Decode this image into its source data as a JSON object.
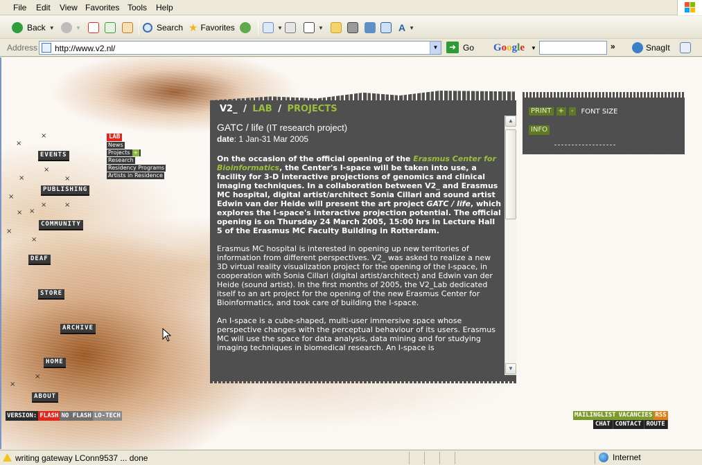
{
  "browser": {
    "menu": [
      "File",
      "Edit",
      "View",
      "Favorites",
      "Tools",
      "Help"
    ],
    "toolbar": {
      "back": "Back",
      "search": "Search",
      "favorites": "Favorites"
    },
    "address": {
      "label": "Address",
      "url": "http://www.v2.nl/",
      "go": "Go"
    },
    "google": {
      "brand": "Google",
      "chevron": "»",
      "snagit": "SnagIt"
    },
    "status": {
      "text": "writing gateway LConn9537 ... done",
      "zone": "Internet"
    }
  },
  "site": {
    "nav": {
      "events": "EVENTS",
      "publishing": "PUBLISHING",
      "community": "COMMUNITY",
      "deaf": "DEAF",
      "store": "STORE",
      "archive": "ARCHIVE",
      "home": "HOME",
      "about": "ABOUT"
    },
    "lab_menu": {
      "head": "LAB",
      "items": [
        "News",
        "Projects",
        "Research",
        "Residency Programs",
        "Artists in Residence"
      ],
      "plus": "+"
    },
    "version": {
      "label": "VERSION:",
      "flash": "FLASH",
      "noflash": "NO FLASH",
      "lotech": "LO-TECH"
    },
    "breadcrumb": {
      "v2": "V2_",
      "lab": "LAB",
      "projects": "PROJECTS",
      "sep": "/"
    },
    "article": {
      "title": "GATC / life",
      "subtitle": "(IT research project)",
      "date_label": "date",
      "date_value": ": 1 Jan-31 Mar 2005",
      "intro_a": "On the occasion of the official opening of the ",
      "intro_link": "Erasmus Center for Bioinformatics",
      "intro_b": ", the Center's I-space will be taken into use, a facility for 3-D interactive projections of genomics and clinical imaging techniques. In a collaboration between V2_ and Erasmus MC hospital, digital artist/architect Sonia Cillari and sound artist Edwin van der Heide will present the art project ",
      "intro_em": "GATC / life",
      "intro_c": ", which explores the I-space's interactive projection potential. The official opening is on Thursday 24 March 2005, 15:00 hrs in Lecture Hall 5 of the Erasmus MC Faculty Building in Rotterdam.",
      "para1": "Erasmus MC hospital is interested in opening up new territories of information from different perspectives. V2_ was asked to realize a new 3D virtual reality visualization project for the opening of the I-space, in cooperation with Sonia Cillari (digital artist/architect) and Edwin van der Heide (sound artist). In the first months of 2005, the V2_Lab dedicated itself to an art project for the opening of the new Erasmus Center for Bioinformatics, and took care of building the I-space.",
      "para2": "An I-space is a cube-shaped, multi-user immersive space whose perspective changes with the perceptual behaviour of its users. Erasmus MC will use the space for data analysis, data mining and for studying imaging techniques in biomedical research. An I-space is"
    },
    "tools": {
      "print": "PRINT",
      "plus": "+",
      "minus": "-",
      "font_size": "FONT SIZE",
      "info": "INFO"
    },
    "footer_links": {
      "mailinglist": "MAILINGLIST",
      "vacancies": "VACANCIES",
      "rss": "RSS",
      "chat": "CHAT",
      "contact": "CONTACT",
      "route": "ROUTE"
    },
    "colors": {
      "accent_green": "#9cbe3c",
      "accent_red": "#e1261c",
      "panel_gray": "#4f4f4f",
      "rss_orange": "#e0801b"
    }
  }
}
